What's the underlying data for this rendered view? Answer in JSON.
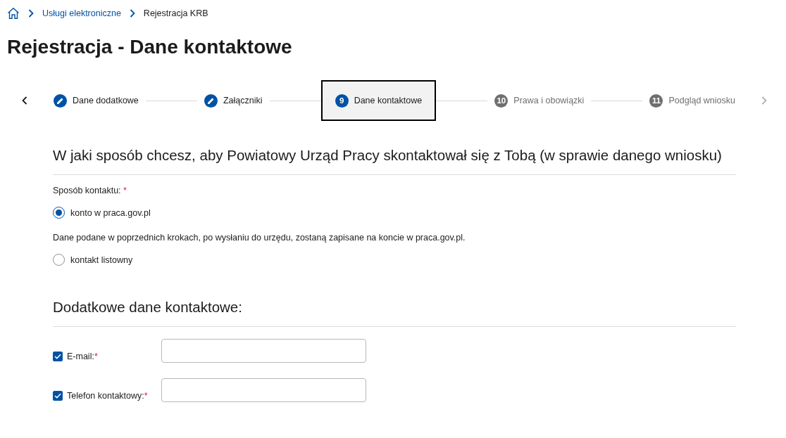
{
  "breadcrumb": {
    "items": [
      {
        "label": "Usługi elektroniczne",
        "kind": "link"
      },
      {
        "label": "Rejestracja KRB",
        "kind": "current"
      }
    ]
  },
  "page_title": "Rejestracja - Dane kontaktowe",
  "stepper": {
    "prev": {
      "disabled": false
    },
    "next": {
      "disabled": true
    },
    "steps": [
      {
        "label": "Dane dodatkowe",
        "kind": "done",
        "selected": false
      },
      {
        "label": "Załączniki",
        "kind": "done",
        "selected": false
      },
      {
        "number": "9",
        "label": "Dane kontaktowe",
        "kind": "current",
        "selected": true
      },
      {
        "number": "10",
        "label": "Prawa i obowiązki",
        "kind": "todo",
        "selected": false
      },
      {
        "number": "11",
        "label": "Podgląd wniosku",
        "kind": "todo",
        "selected": false
      }
    ]
  },
  "contact_section": {
    "heading": "W jaki sposób chcesz, aby Powiatowy Urząd Pracy skontaktował się z Tobą (w sprawie danego wniosku)",
    "field_label": "Sposób kontaktu:",
    "required_mark": "*",
    "options": [
      {
        "label": "konto w praca.gov.pl",
        "selected": true,
        "note": "Dane podane w poprzednich krokach, po wysłaniu do urzędu, zostaną zapisane na koncie w praca.gov.pl."
      },
      {
        "label": "kontakt listowny",
        "selected": false
      }
    ]
  },
  "additional_section": {
    "heading": "Dodatkowe dane kontaktowe:",
    "fields": [
      {
        "label": "E-mail:",
        "required_mark": "*",
        "checked": true
      },
      {
        "label": "Telefon kontaktowy:",
        "required_mark": "*",
        "checked": true
      }
    ]
  }
}
